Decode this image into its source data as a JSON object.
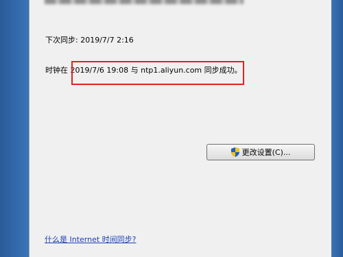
{
  "dialog": {
    "next_sync": "下次同步: 2019/7/7 2:16",
    "sync_prefix": "时钟在 ",
    "sync_detail": "2019/7/6 19:08 与 ntp1.aliyun.com 同步成功。",
    "change_settings_label": "更改设置(C)...",
    "help_link": "什么是 Internet 时间同步?"
  },
  "icons": {
    "change_settings": "uac-shield-icon"
  },
  "colors": {
    "desktop_blue": "#2f63a3",
    "dialog_bg": "#f0f0f0",
    "highlight": "#e02020",
    "link": "#1a3fb0"
  }
}
